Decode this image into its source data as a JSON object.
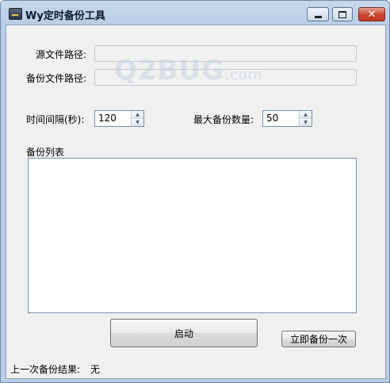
{
  "window": {
    "title": "Wy定时备份工具",
    "minimize_glyph": "minimize-icon",
    "maximize_glyph": "maximize-icon",
    "close_label": "✕"
  },
  "form": {
    "source_path_label": "源文件路径:",
    "source_path_value": "",
    "backup_path_label": "备份文件路径:",
    "backup_path_value": "",
    "interval_label": "时间间隔(秒):",
    "interval_value": "120",
    "max_backups_label": "最大备份数量:",
    "max_backups_value": "50",
    "backup_list_label": "备份列表",
    "backup_list_items": [],
    "start_button": "启动",
    "backup_now_button": "立即备份一次",
    "last_result_label": "上一次备份结果:",
    "last_result_value": "无"
  },
  "watermark": {
    "text": "Q2BUG",
    "suffix": ".com"
  },
  "colors": {
    "title_bar": "#b9cde5",
    "client_bg": "#f0f0f0",
    "close_button": "#c8452f"
  }
}
